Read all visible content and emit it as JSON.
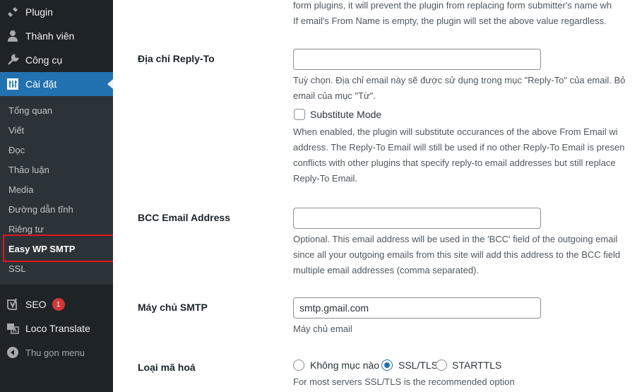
{
  "sidebar": {
    "menu": [
      {
        "label": "Plugin",
        "icon": "plugin-icon"
      },
      {
        "label": "Thành viên",
        "icon": "users-icon"
      },
      {
        "label": "Công cụ",
        "icon": "tools-icon"
      },
      {
        "label": "Cài đặt",
        "icon": "settings-icon"
      }
    ],
    "submenu": [
      "Tổng quan",
      "Viết",
      "Đọc",
      "Thảo luận",
      "Media",
      "Đường dẫn tĩnh",
      "Riêng tư",
      "Easy WP SMTP",
      "SSL"
    ],
    "extra": [
      {
        "label": "SEO",
        "icon": "yoast-seo-icon",
        "badge": "1"
      },
      {
        "label": "Loco Translate",
        "icon": "translate-icon"
      }
    ],
    "collapse_label": "Thu gọn menu",
    "accent_color": "#2271b1",
    "highlight_color": "#e0141b"
  },
  "main": {
    "top_desc": [
      "form plugins, it will prevent the plugin from replacing form submitter's name wh",
      "If email's From Name is empty, the plugin will set the above value regardless."
    ],
    "reply_to": {
      "label": "Địa chỉ Reply-To",
      "value": "",
      "desc": [
        "Tuỳ chọn. Địa chỉ email này sẽ được sử dụng trong mục \"Reply-To\" của email. Bỏ",
        "email của mục \"Từ\"."
      ],
      "substitute_label": "Substitute Mode",
      "substitute_checked": false,
      "substitute_desc": [
        "When enabled, the plugin will substitute occurances of the above From Email wi",
        "address. The Reply-To Email will still be used if no other Reply-To Email is presen",
        "conflicts with other plugins that specify reply-to email addresses but still replace",
        "Reply-To Email."
      ]
    },
    "bcc": {
      "label": "BCC Email Address",
      "value": "",
      "desc": [
        "Optional. This email address will be used in the 'BCC' field of the outgoing email",
        "since all your outgoing emails from this site will add this address to the BCC field",
        "multiple email addresses (comma separated)."
      ]
    },
    "smtp_host": {
      "label": "Máy chủ SMTP",
      "value": "smtp.gmail.com",
      "desc": "Máy chủ email"
    },
    "encryption": {
      "label": "Loại mã hoá",
      "options": [
        "Không mục nào",
        "SSL/TLS",
        "STARTTLS"
      ],
      "selected": "SSL/TLS",
      "desc": "For most servers SSL/TLS is the recommended option"
    }
  }
}
